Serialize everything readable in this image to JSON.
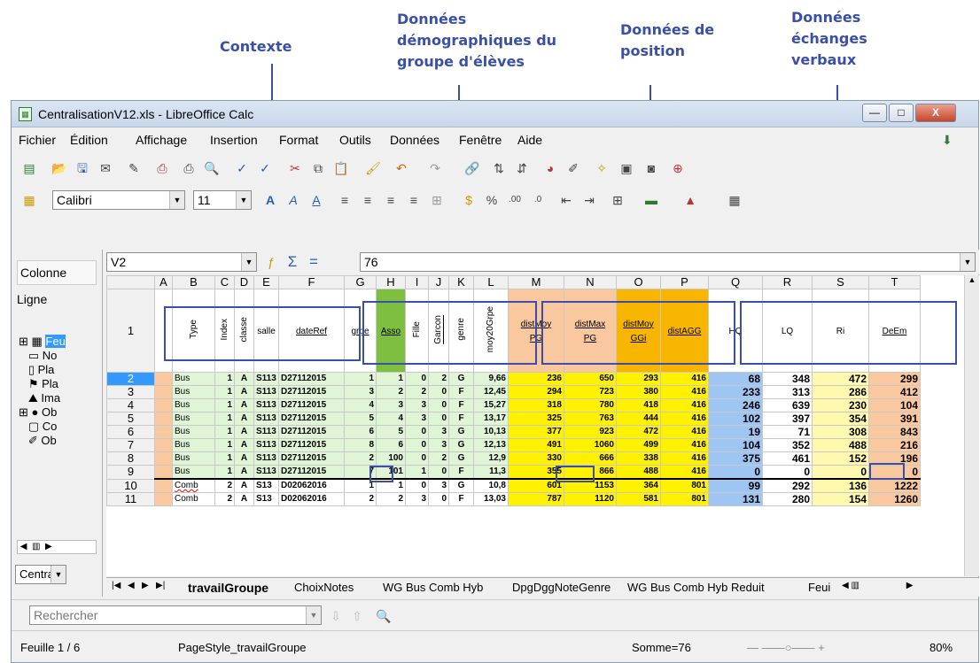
{
  "annotations": {
    "contexte": "Contexte",
    "demo": "Données\ndémographiques du\ngroupe d'élèves",
    "position": "Données de\nposition",
    "echanges": "Données\néchanges\nverbaux"
  },
  "window": {
    "title": "CentralisationV12.xls - LibreOffice Calc",
    "minimize": "—",
    "maximize": "□",
    "close": "X"
  },
  "menu": [
    "Fichier",
    "Édition",
    "Affichage",
    "Insertion",
    "Format",
    "Outils",
    "Données",
    "Fenêtre",
    "Aide"
  ],
  "format_toolbar": {
    "font": "Calibri",
    "size": "11"
  },
  "formula": {
    "cell": "V2",
    "value": "76",
    "sum": "Σ",
    "eq": "="
  },
  "side": {
    "colonne": "Colonne",
    "ligne": "Ligne",
    "items": [
      "Feu",
      "No",
      "Pla",
      "Pla",
      "Ima",
      "Ob",
      "Co",
      "Ob"
    ],
    "dropdown": "Central"
  },
  "columns": [
    "A",
    "B",
    "C",
    "D",
    "E",
    "F",
    "G",
    "H",
    "I",
    "J",
    "K",
    "L",
    "M",
    "N",
    "O",
    "P",
    "Q",
    "R",
    "S",
    "T"
  ],
  "header_row": {
    "num": "1",
    "B": "Type",
    "C": "Index",
    "D": "classe",
    "E": "salle",
    "F": "dateRef",
    "G": "grpe",
    "H": "Asso",
    "I": "Fille",
    "J": "Garcon",
    "K": "genre",
    "L": "moy20Grpe",
    "M": "distMoy\nPG",
    "N": "distMax\nPG",
    "O": "distMoy\nGGi",
    "P": "distAGG",
    "Q": "HQ",
    "R": "LQ",
    "S": "Ri",
    "T": "DeEm"
  },
  "rows": [
    [
      "2",
      "",
      "Bus",
      "1",
      "A",
      "S113",
      "D27112015",
      "1",
      "1",
      "0",
      "2",
      "G",
      "9,66",
      "236",
      "650",
      "293",
      "416",
      "68",
      "348",
      "472",
      "299"
    ],
    [
      "3",
      "",
      "Bus",
      "1",
      "A",
      "S113",
      "D27112015",
      "3",
      "2",
      "2",
      "0",
      "F",
      "12,45",
      "294",
      "723",
      "380",
      "416",
      "233",
      "313",
      "286",
      "412"
    ],
    [
      "4",
      "",
      "Bus",
      "1",
      "A",
      "S113",
      "D27112015",
      "4",
      "3",
      "3",
      "0",
      "F",
      "15,27",
      "318",
      "780",
      "418",
      "416",
      "246",
      "639",
      "230",
      "104"
    ],
    [
      "5",
      "",
      "Bus",
      "1",
      "A",
      "S113",
      "D27112015",
      "5",
      "4",
      "3",
      "0",
      "F",
      "13,17",
      "325",
      "763",
      "444",
      "416",
      "102",
      "397",
      "354",
      "391"
    ],
    [
      "6",
      "",
      "Bus",
      "1",
      "A",
      "S113",
      "D27112015",
      "6",
      "5",
      "0",
      "3",
      "G",
      "10,13",
      "377",
      "923",
      "472",
      "416",
      "19",
      "71",
      "308",
      "843"
    ],
    [
      "7",
      "",
      "Bus",
      "1",
      "A",
      "S113",
      "D27112015",
      "8",
      "6",
      "0",
      "3",
      "G",
      "12,13",
      "491",
      "1060",
      "499",
      "416",
      "104",
      "352",
      "488",
      "216"
    ],
    [
      "8",
      "",
      "Bus",
      "1",
      "A",
      "S113",
      "D27112015",
      "2",
      "100",
      "0",
      "2",
      "G",
      "12,9",
      "330",
      "666",
      "338",
      "416",
      "375",
      "461",
      "152",
      "196"
    ],
    [
      "9",
      "",
      "Bus",
      "1",
      "A",
      "S113",
      "D27112015",
      "7",
      "101",
      "1",
      "0",
      "F",
      "11,3",
      "355",
      "866",
      "488",
      "416",
      "0",
      "0",
      "0",
      "0"
    ],
    [
      "10",
      "",
      "Comb",
      "2",
      "A",
      "S13",
      "D02062016",
      "1",
      "1",
      "0",
      "3",
      "G",
      "10,8",
      "601",
      "1153",
      "364",
      "801",
      "99",
      "292",
      "136",
      "1222"
    ],
    [
      "11",
      "",
      "Comb",
      "2",
      "A",
      "S13",
      "D02062016",
      "2",
      "2",
      "3",
      "0",
      "F",
      "13,03",
      "787",
      "1120",
      "581",
      "801",
      "131",
      "280",
      "154",
      "1260"
    ]
  ],
  "sheet_tabs": [
    "travailGroupe",
    "ChoixNotes",
    "WG Bus Comb Hyb",
    "DpgDggNoteGenre",
    "WG Bus Comb Hyb Reduit",
    "Feui"
  ],
  "find": {
    "placeholder": "Rechercher"
  },
  "status": {
    "sheet": "Feuille 1 / 6",
    "style": "PageStyle_travailGroupe",
    "sum": "Somme=76",
    "zoom": "80%"
  }
}
